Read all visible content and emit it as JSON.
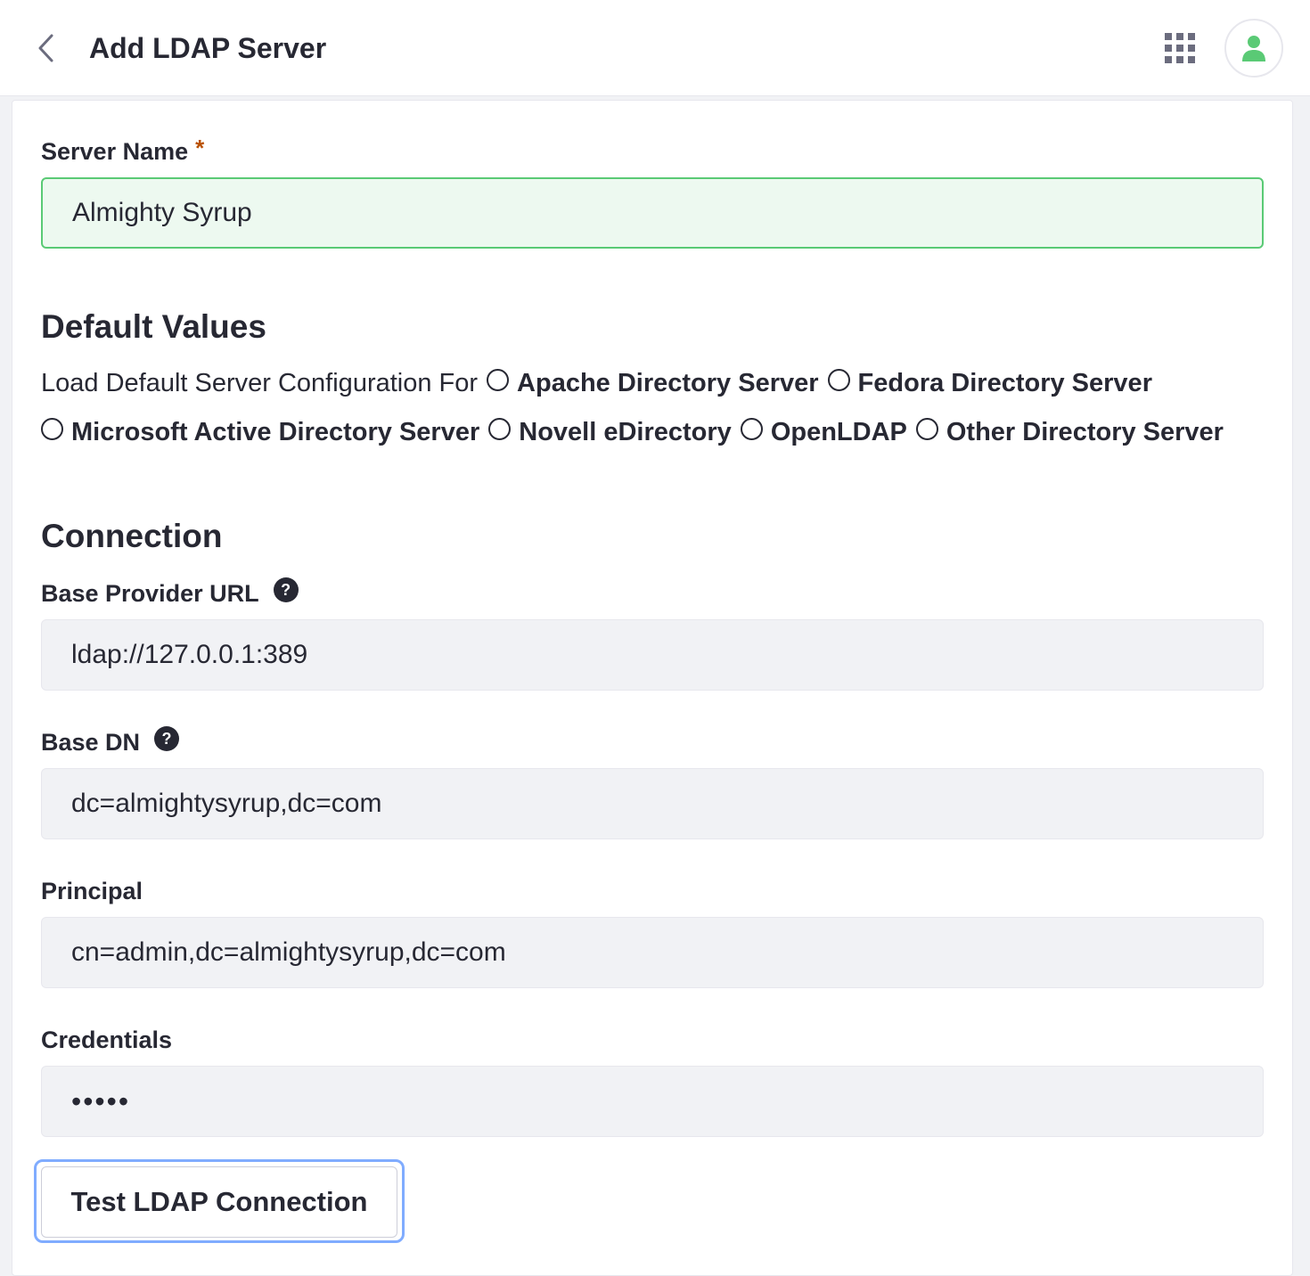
{
  "header": {
    "title": "Add LDAP Server",
    "back_icon": "chevron-left-icon",
    "apps_icon": "apps-grid-icon",
    "avatar_icon": "user-icon",
    "avatar_color": "#5aca75"
  },
  "server_name": {
    "label": "Server Name",
    "required_marker": "*",
    "value": "Almighty Syrup"
  },
  "default_values": {
    "heading": "Default Values",
    "lead_text": "Load Default Server Configuration For",
    "options": [
      "Apache Directory Server",
      "Fedora Directory Server",
      "Microsoft Active Directory Server",
      "Novell eDirectory",
      "OpenLDAP",
      "Other Directory Server"
    ]
  },
  "connection": {
    "heading": "Connection",
    "base_provider_url": {
      "label": "Base Provider URL",
      "help": "?",
      "value": "ldap://127.0.0.1:389"
    },
    "base_dn": {
      "label": "Base DN",
      "help": "?",
      "value": "dc=almightysyrup,dc=com"
    },
    "principal": {
      "label": "Principal",
      "value": "cn=admin,dc=almightysyrup,dc=com"
    },
    "credentials": {
      "label": "Credentials",
      "value": "•••••"
    },
    "test_button": "Test LDAP Connection"
  }
}
